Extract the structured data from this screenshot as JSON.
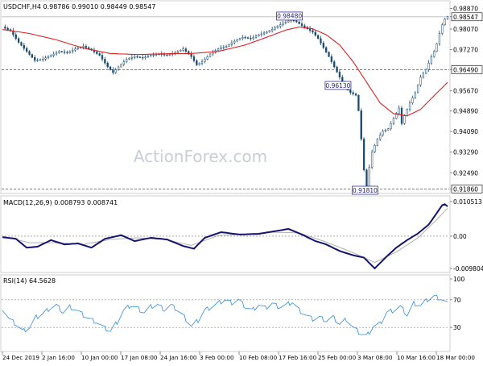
{
  "chart_data": [
    {
      "type": "candlestick",
      "title": "USDCHF,H4 0.98786 0.99010 0.98449 0.98547",
      "watermark": "ActionForex.com",
      "x_tick_labels": [
        "24 Dec 2019",
        "2 Jan 16:00",
        "10 Jan 00:00",
        "17 Jan 08:00",
        "24 Jan 16:00",
        "3 Feb 00:00",
        "10 Feb 08:00",
        "17 Feb 16:00",
        "25 Feb 00:00",
        "3 Mar 08:00",
        "10 Mar 16:00",
        "18 Mar 00:00"
      ],
      "y_tick_labels": [
        "0.98870",
        "0.98547",
        "0.98070",
        "0.97270",
        "0.96490",
        "0.95670",
        "0.94890",
        "0.94090",
        "0.93290",
        "0.92490",
        "0.91860"
      ],
      "ylim": [
        0.9181,
        0.9901
      ],
      "last_price": 0.98547,
      "horizontal_levels": [
        0.9649,
        0.9186
      ],
      "annotations": [
        {
          "text": "0.98480",
          "value": 0.9848
        },
        {
          "text": "0.96130",
          "value": 0.9613
        },
        {
          "text": "0.91810",
          "value": 0.9181
        }
      ],
      "close_path": [
        [
          0,
          0.9815
        ],
        [
          6,
          0.98
        ],
        [
          12,
          0.9755
        ],
        [
          18,
          0.972
        ],
        [
          24,
          0.9685
        ],
        [
          30,
          0.969
        ],
        [
          36,
          0.9705
        ],
        [
          42,
          0.972
        ],
        [
          48,
          0.9715
        ],
        [
          54,
          0.973
        ],
        [
          60,
          0.974
        ],
        [
          66,
          0.9725
        ],
        [
          72,
          0.9705
        ],
        [
          78,
          0.966
        ],
        [
          82,
          0.9638
        ],
        [
          86,
          0.966
        ],
        [
          92,
          0.969
        ],
        [
          98,
          0.97
        ],
        [
          104,
          0.9695
        ],
        [
          110,
          0.9705
        ],
        [
          116,
          0.971
        ],
        [
          122,
          0.9705
        ],
        [
          128,
          0.9715
        ],
        [
          134,
          0.973
        ],
        [
          140,
          0.97
        ],
        [
          144,
          0.9668
        ],
        [
          148,
          0.968
        ],
        [
          154,
          0.971
        ],
        [
          160,
          0.973
        ],
        [
          166,
          0.974
        ],
        [
          172,
          0.976
        ],
        [
          178,
          0.9775
        ],
        [
          184,
          0.977
        ],
        [
          190,
          0.9785
        ],
        [
          196,
          0.9795
        ],
        [
          202,
          0.9812
        ],
        [
          208,
          0.983
        ],
        [
          214,
          0.9843
        ],
        [
          218,
          0.9835
        ],
        [
          222,
          0.982
        ],
        [
          226,
          0.9808
        ],
        [
          230,
          0.9795
        ],
        [
          234,
          0.977
        ],
        [
          238,
          0.9735
        ],
        [
          242,
          0.97
        ],
        [
          246,
          0.966
        ],
        [
          250,
          0.962
        ],
        [
          254,
          0.958
        ],
        [
          258,
          0.956
        ],
        [
          262,
          0.955
        ],
        [
          264,
          0.949
        ],
        [
          266,
          0.938
        ],
        [
          268,
          0.926
        ],
        [
          270,
          0.919
        ],
        [
          272,
          0.927
        ],
        [
          274,
          0.933
        ],
        [
          278,
          0.938
        ],
        [
          282,
          0.941
        ],
        [
          286,
          0.942
        ],
        [
          290,
          0.946
        ],
        [
          294,
          0.95
        ],
        [
          296,
          0.944
        ],
        [
          298,
          0.947
        ],
        [
          302,
          0.952
        ],
        [
          306,
          0.956
        ],
        [
          310,
          0.962
        ],
        [
          314,
          0.965
        ],
        [
          318,
          0.97
        ],
        [
          321,
          0.973
        ],
        [
          324,
          0.979
        ],
        [
          327,
          0.984
        ],
        [
          330,
          0.9855
        ]
      ],
      "sma_path": [
        [
          0,
          0.9805
        ],
        [
          20,
          0.979
        ],
        [
          40,
          0.9765
        ],
        [
          60,
          0.9733
        ],
        [
          80,
          0.9712
        ],
        [
          100,
          0.9708
        ],
        [
          120,
          0.9711
        ],
        [
          140,
          0.9712
        ],
        [
          160,
          0.972
        ],
        [
          180,
          0.9745
        ],
        [
          200,
          0.9783
        ],
        [
          210,
          0.9803
        ],
        [
          220,
          0.9815
        ],
        [
          230,
          0.9808
        ],
        [
          240,
          0.9785
        ],
        [
          250,
          0.9745
        ],
        [
          260,
          0.968
        ],
        [
          270,
          0.96
        ],
        [
          280,
          0.952
        ],
        [
          290,
          0.9478
        ],
        [
          300,
          0.947
        ],
        [
          310,
          0.9495
        ],
        [
          320,
          0.9548
        ],
        [
          330,
          0.96
        ]
      ]
    },
    {
      "type": "line",
      "title": "MACD(12,26,9) 0.008793 0.008741",
      "y_tick_labels": [
        "0.010513",
        "0.00",
        "-0.009804"
      ],
      "ylim": [
        -0.0098,
        0.0105
      ],
      "series": [
        {
          "values": [
            [
              0,
              -0.0003
            ],
            [
              10,
              -0.0008
            ],
            [
              18,
              -0.0035
            ],
            [
              26,
              -0.0032
            ],
            [
              36,
              -0.0012
            ],
            [
              46,
              -0.0025
            ],
            [
              56,
              -0.0022
            ],
            [
              66,
              -0.0035
            ],
            [
              76,
              -0.0008
            ],
            [
              88,
              0.0003
            ],
            [
              98,
              -0.0015
            ],
            [
              110,
              -0.0005
            ],
            [
              122,
              -0.001
            ],
            [
              134,
              -0.003
            ],
            [
              142,
              -0.0038
            ],
            [
              150,
              -0.0005
            ],
            [
              162,
              0.0012
            ],
            [
              176,
              0.0005
            ],
            [
              190,
              0.0007
            ],
            [
              202,
              0.0015
            ],
            [
              212,
              0.0022
            ],
            [
              222,
              0.0005
            ],
            [
              232,
              -0.0015
            ],
            [
              240,
              -0.0025
            ],
            [
              250,
              -0.0045
            ],
            [
              260,
              -0.0058
            ],
            [
              268,
              -0.0065
            ],
            [
              276,
              -0.0098
            ],
            [
              284,
              -0.0065
            ],
            [
              292,
              -0.0035
            ],
            [
              300,
              -0.0012
            ],
            [
              308,
              0.0008
            ],
            [
              316,
              0.0035
            ],
            [
              322,
              0.007
            ],
            [
              327,
              0.01
            ],
            [
              330,
              0.009
            ]
          ]
        },
        {
          "values": [
            [
              0,
              0.0
            ],
            [
              20,
              -0.002
            ],
            [
              40,
              -0.002
            ],
            [
              60,
              -0.0025
            ],
            [
              80,
              -0.001
            ],
            [
              100,
              -0.0005
            ],
            [
              120,
              -0.001
            ],
            [
              140,
              -0.0028
            ],
            [
              160,
              0.0002
            ],
            [
              180,
              0.0006
            ],
            [
              200,
              0.0012
            ],
            [
              220,
              0.001
            ],
            [
              240,
              -0.0018
            ],
            [
              260,
              -0.005
            ],
            [
              276,
              -0.008
            ],
            [
              292,
              -0.0048
            ],
            [
              308,
              -0.0005
            ],
            [
              322,
              0.005
            ],
            [
              330,
              0.0085
            ]
          ]
        }
      ]
    },
    {
      "type": "line",
      "title": "RSI(14) 64.5628",
      "y_tick_labels": [
        "100",
        "70",
        "30",
        "0"
      ],
      "ylim": [
        0,
        100
      ],
      "levels": [
        70,
        30
      ],
      "values": [
        [
          0,
          58
        ],
        [
          5,
          42
        ],
        [
          10,
          35
        ],
        [
          15,
          25
        ],
        [
          20,
          30
        ],
        [
          25,
          45
        ],
        [
          30,
          50
        ],
        [
          35,
          58
        ],
        [
          40,
          62
        ],
        [
          45,
          52
        ],
        [
          50,
          60
        ],
        [
          55,
          55
        ],
        [
          60,
          48
        ],
        [
          65,
          42
        ],
        [
          70,
          38
        ],
        [
          75,
          30
        ],
        [
          80,
          25
        ],
        [
          85,
          38
        ],
        [
          90,
          55
        ],
        [
          95,
          62
        ],
        [
          100,
          58
        ],
        [
          105,
          52
        ],
        [
          110,
          60
        ],
        [
          115,
          63
        ],
        [
          120,
          56
        ],
        [
          125,
          62
        ],
        [
          130,
          55
        ],
        [
          135,
          45
        ],
        [
          140,
          32
        ],
        [
          145,
          40
        ],
        [
          150,
          55
        ],
        [
          155,
          60
        ],
        [
          160,
          65
        ],
        [
          165,
          70
        ],
        [
          170,
          66
        ],
        [
          175,
          70
        ],
        [
          180,
          60
        ],
        [
          185,
          55
        ],
        [
          190,
          63
        ],
        [
          195,
          58
        ],
        [
          200,
          65
        ],
        [
          205,
          60
        ],
        [
          210,
          62
        ],
        [
          215,
          67
        ],
        [
          220,
          55
        ],
        [
          225,
          48
        ],
        [
          230,
          42
        ],
        [
          235,
          45
        ],
        [
          240,
          40
        ],
        [
          245,
          45
        ],
        [
          250,
          35
        ],
        [
          255,
          42
        ],
        [
          260,
          30
        ],
        [
          265,
          22
        ],
        [
          270,
          18
        ],
        [
          275,
          32
        ],
        [
          280,
          35
        ],
        [
          285,
          52
        ],
        [
          290,
          55
        ],
        [
          295,
          60
        ],
        [
          300,
          48
        ],
        [
          305,
          65
        ],
        [
          310,
          62
        ],
        [
          315,
          70
        ],
        [
          320,
          75
        ],
        [
          325,
          72
        ],
        [
          330,
          65
        ]
      ]
    }
  ]
}
